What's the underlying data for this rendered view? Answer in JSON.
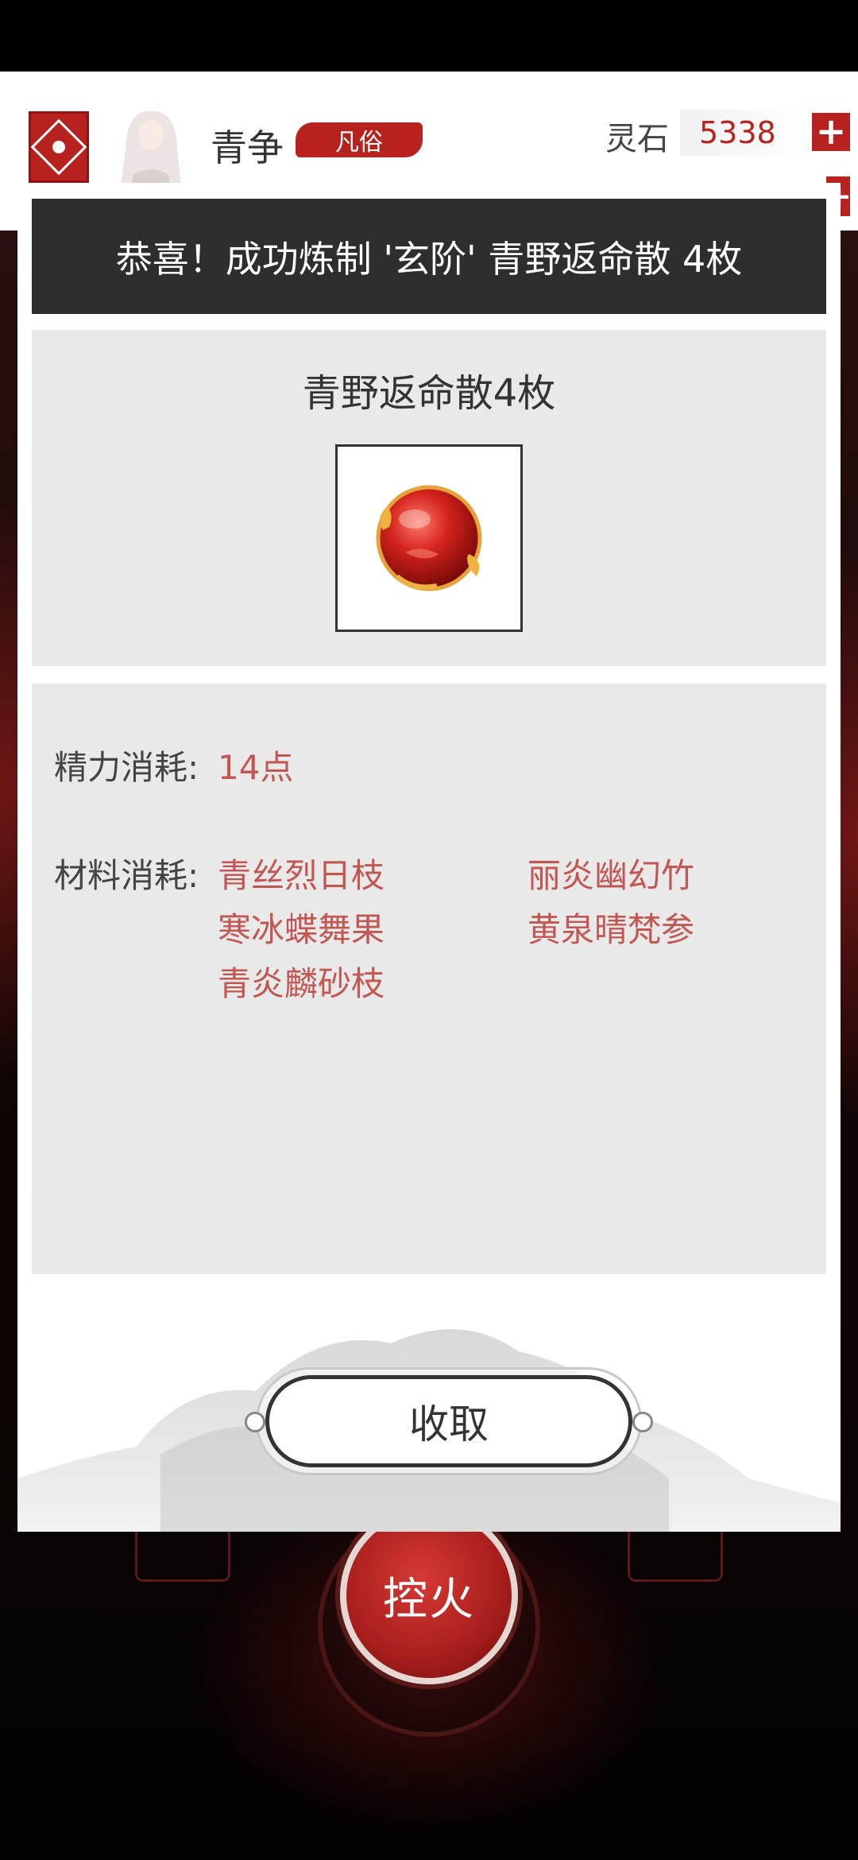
{
  "header": {
    "player_name": "青争",
    "rank": "凡俗",
    "stone_label": "灵石",
    "stone_value": "5338",
    "plus_symbol": "+"
  },
  "dialog": {
    "title": "恭喜！成功炼制 '玄阶' 青野返命散 4枚",
    "item_name": "青野返命散4枚",
    "item_icon": "red-pill-orb-icon",
    "energy_label": "精力消耗:",
    "energy_value": "14点",
    "materials_label": "材料消耗:",
    "materials": [
      "青丝烈日枝",
      "丽炎幽幻竹",
      "寒冰蝶舞果",
      "黄泉晴梵参",
      "青炎麟砂枝"
    ],
    "collect_label": "收取"
  },
  "background": {
    "fire_button_label": "控火"
  },
  "colors": {
    "accent_red": "#b8221e",
    "value_red": "#c25752",
    "title_bar": "#2e2e2e",
    "panel_gray": "#e9e9e9"
  }
}
